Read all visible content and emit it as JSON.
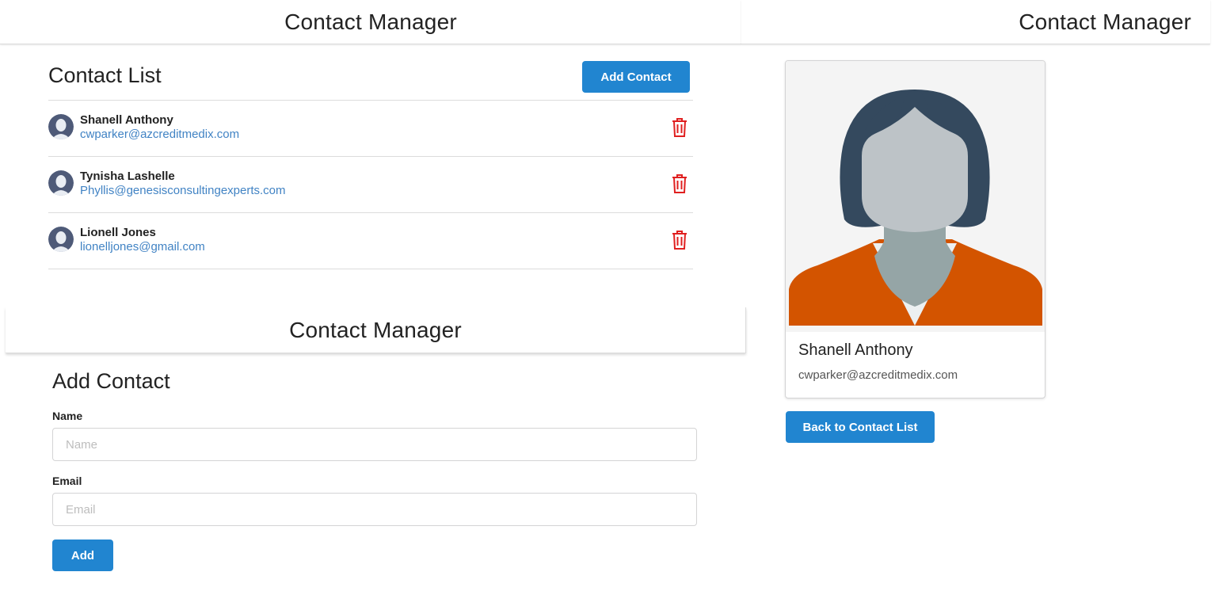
{
  "app": {
    "title": "Contact Manager"
  },
  "contact_list": {
    "title": "Contact List",
    "add_button_label": "Add Contact",
    "contacts": [
      {
        "name": "Shanell Anthony",
        "email": "cwparker@azcreditmedix.com"
      },
      {
        "name": "Tynisha Lashelle",
        "email": "Phyllis@genesisconsultingexperts.com"
      },
      {
        "name": "Lionell Jones",
        "email": "lionelljones@gmail.com"
      }
    ]
  },
  "add_form": {
    "title": "Add Contact",
    "name_label": "Name",
    "name_placeholder": "Name",
    "name_value": "",
    "email_label": "Email",
    "email_placeholder": "Email",
    "email_value": "",
    "submit_label": "Add"
  },
  "detail": {
    "name": "Shanell Anthony",
    "email": "cwparker@azcreditmedix.com",
    "back_button_label": "Back to Contact List"
  },
  "icons": {
    "delete": "trash-icon",
    "avatar": "user-avatar-icon"
  },
  "colors": {
    "primary": "#2185d0",
    "link": "#4183c4",
    "danger": "#e02020",
    "hair": "#34495e",
    "skin": "#bdc3c7",
    "neck": "#95a5a6",
    "jacket": "#d35400"
  }
}
